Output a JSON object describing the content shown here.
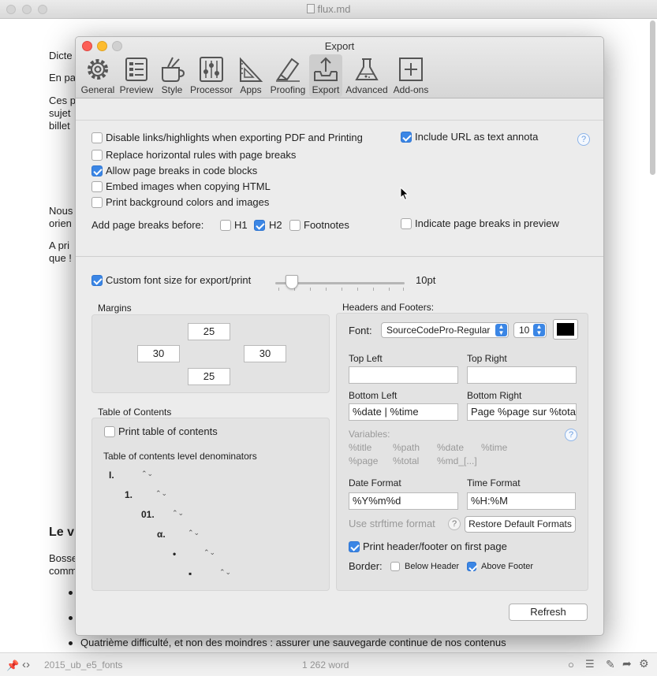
{
  "editor": {
    "title": "flux.md",
    "lines": [
      "Dicte",
      "En pa",
      "Ces p",
      "sujet",
      "billet",
      "Nous",
      "orien",
      "A pri",
      "que !"
    ],
    "heading": "Le v",
    "para_lines": [
      "Bosse",
      "comm"
    ],
    "last_line": "Quatrième difficulté, et non des moindres : assurer une sauvegarde continue de nos contenus",
    "status": {
      "filename": "2015_ub_e5_fonts",
      "word_count": "1 262 word"
    }
  },
  "dialog": {
    "title": "Export",
    "tabs": [
      {
        "label": "General",
        "icon": "gear-icon"
      },
      {
        "label": "Preview",
        "icon": "preview-icon"
      },
      {
        "label": "Style",
        "icon": "style-icon"
      },
      {
        "label": "Processor",
        "icon": "sliders-icon"
      },
      {
        "label": "Apps",
        "icon": "apps-icon"
      },
      {
        "label": "Proofing",
        "icon": "highlighter-icon"
      },
      {
        "label": "Export",
        "icon": "export-tray-icon"
      },
      {
        "label": "Advanced",
        "icon": "flask-icon"
      },
      {
        "label": "Add-ons",
        "icon": "plus-box-icon"
      }
    ],
    "active_tab": "Export",
    "options": {
      "disable_links": {
        "label": "Disable links/highlights when exporting PDF and Printing",
        "checked": false
      },
      "replace_hr": {
        "label": "Replace horizontal rules with page breaks",
        "checked": false
      },
      "allow_breaks": {
        "label": "Allow page breaks in code blocks",
        "checked": true
      },
      "embed_images": {
        "label": "Embed images when copying HTML",
        "checked": false
      },
      "print_bg": {
        "label": "Print background colors and images",
        "checked": false
      },
      "include_url": {
        "label": "Include URL as text annota",
        "checked": true
      },
      "indicate_breaks": {
        "label": "Indicate page breaks in preview",
        "checked": false
      }
    },
    "page_breaks": {
      "label": "Add page breaks before:",
      "h1": {
        "label": "H1",
        "checked": false
      },
      "h2": {
        "label": "H2",
        "checked": true
      },
      "footnotes": {
        "label": "Footnotes",
        "checked": false
      }
    },
    "help_glyph": "?",
    "custom_font": {
      "label": "Custom font size for export/print",
      "checked": true,
      "value_label": "10pt",
      "level": 0.15
    },
    "margins": {
      "label": "Margins",
      "top": "25",
      "left": "30",
      "right": "30",
      "bottom": "25"
    },
    "toc": {
      "label": "Table of Contents",
      "print": {
        "label": "Print table of contents",
        "checked": false
      },
      "denominators_label": "Table of contents level denominators",
      "levels": [
        "I.",
        "1.",
        "01.",
        "α.",
        "•",
        "▪"
      ],
      "stepper_glyph": "⌃⌄"
    },
    "hf": {
      "label": "Headers and Footers:",
      "font_label": "Font:",
      "font_name": "SourceCodePro-Regular",
      "font_size": "10",
      "color": "#000000",
      "top_left_label": "Top Left",
      "top_left": "",
      "top_right_label": "Top Right",
      "top_right": "",
      "bottom_left_label": "Bottom Left",
      "bottom_left": "%date | %time",
      "bottom_right_label": "Bottom Right",
      "bottom_right": "Page %page sur %tota",
      "variables_label": "Variables:",
      "variables": [
        "%title",
        "%path",
        "%date",
        "%time",
        "%page",
        "%total",
        "%md_[...]"
      ],
      "date_format_label": "Date Format",
      "date_format": "%Y%m%d",
      "time_format_label": "Time Format",
      "time_format": "%H:%M",
      "strftime_label": "Use strftime format",
      "restore_label": "Restore Default Formats",
      "first_page": {
        "label": "Print header/footer on first page",
        "checked": true
      },
      "border_label": "Border:",
      "below_header": {
        "label": "Below Header",
        "checked": false
      },
      "above_footer": {
        "label": "Above Footer",
        "checked": true
      }
    },
    "refresh_label": "Refresh"
  }
}
